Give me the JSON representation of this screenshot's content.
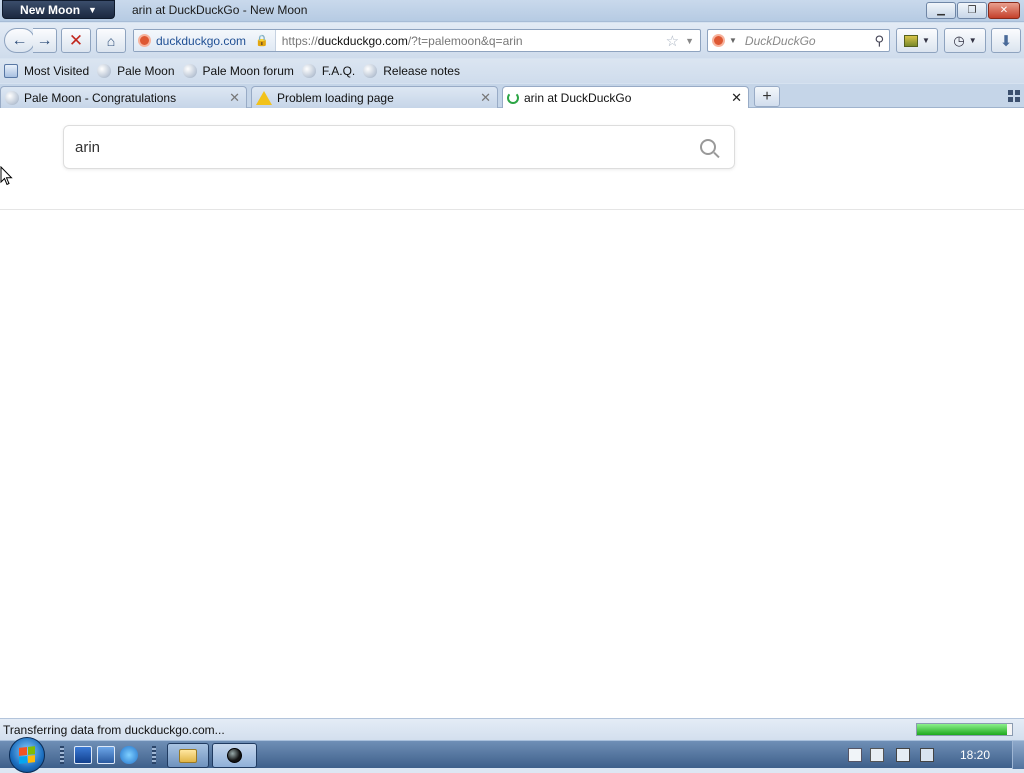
{
  "window": {
    "app_button": "New Moon",
    "title": "arin at DuckDuckGo - New Moon"
  },
  "navbar": {
    "identity_label": "duckduckgo.com",
    "url_scheme": "https://",
    "url_host": "duckduckgo.com",
    "url_path": "/?t=palemoon&q=arin",
    "search_placeholder": "DuckDuckGo"
  },
  "bookmarks": [
    {
      "label": "Most Visited",
      "icon": "most-visited-icon"
    },
    {
      "label": "Pale Moon",
      "icon": "globe-icon"
    },
    {
      "label": "Pale Moon forum",
      "icon": "globe-icon"
    },
    {
      "label": "F.A.Q.",
      "icon": "globe-icon"
    },
    {
      "label": "Release notes",
      "icon": "globe-icon"
    }
  ],
  "tabs": [
    {
      "label": "Pale Moon - Congratulations",
      "icon": "globe-icon",
      "active": false
    },
    {
      "label": "Problem loading page",
      "icon": "warning-icon",
      "active": false
    },
    {
      "label": "arin at DuckDuckGo",
      "icon": "loading-spinner-icon",
      "active": true
    }
  ],
  "page": {
    "search_value": "arin"
  },
  "status": {
    "text": "Transferring data from duckduckgo.com...",
    "progress": 0.95
  },
  "taskbar": {
    "clock": "18:20"
  },
  "colors": {
    "progress": "#1ea91e",
    "stop": "#c1271e",
    "ddg": "#de5833",
    "close": "#c4402b"
  }
}
